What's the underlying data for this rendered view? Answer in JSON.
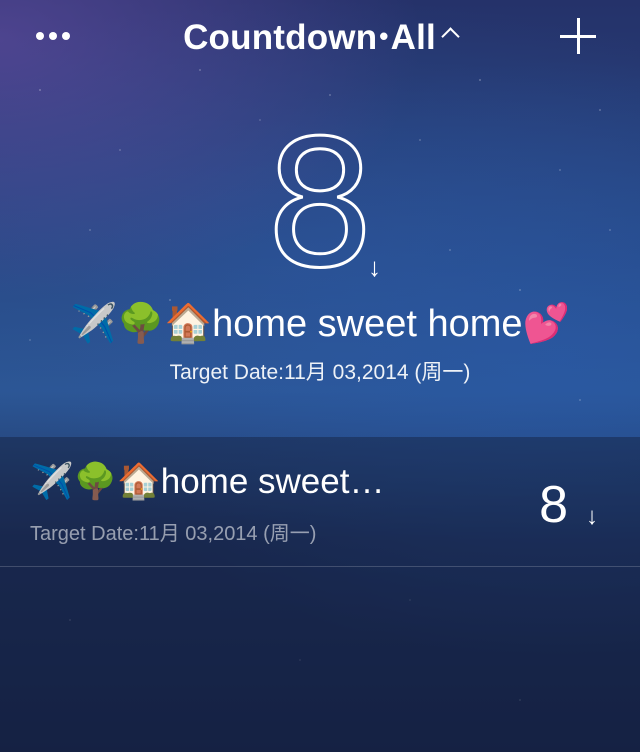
{
  "header": {
    "title_main": "Countdown",
    "title_separator": "•",
    "title_filter": "All"
  },
  "hero": {
    "days": "8",
    "direction_arrow": "↓",
    "emoji_prefix": "✈️🌳🏠",
    "title": "home sweet home",
    "emoji_suffix": "💕",
    "target_date": "Target Date:11月 03,2014 (周一)"
  },
  "list": {
    "items": [
      {
        "emoji_prefix": "✈️🌳🏠",
        "title": "home sweet…",
        "target_date": "Target Date:11月 03,2014 (周一)",
        "days": "8",
        "direction_arrow": "↓"
      }
    ]
  },
  "icons": {
    "more": "more-dots-icon",
    "add": "plus-icon",
    "caret": "chevron-up-icon"
  },
  "colors": {
    "text": "#ffffff",
    "secondary_text": "#a9b3c9",
    "background_top": "#25326a",
    "background_bottom": "#16244a"
  }
}
